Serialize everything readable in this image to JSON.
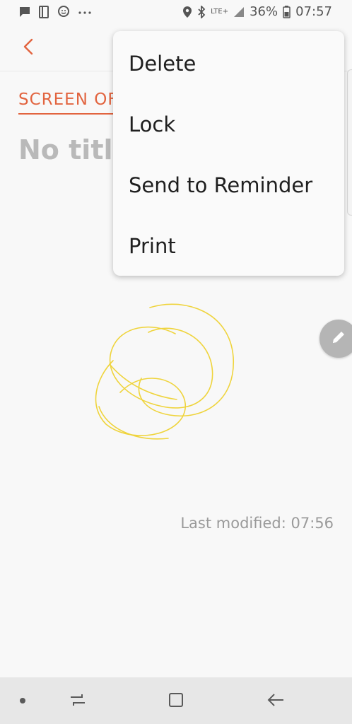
{
  "status_bar": {
    "network": "LTE+",
    "battery": "36%",
    "time": "07:57"
  },
  "note": {
    "category": "SCREEN OF",
    "title": "No title",
    "last_modified": "Last modified: 07:56"
  },
  "menu": {
    "items": [
      "Delete",
      "Lock",
      "Send to Reminder",
      "Print"
    ]
  },
  "icons": {
    "back": "chevron-left-icon",
    "edit": "pencil-icon",
    "recents": "recent-apps-icon",
    "home": "home-icon",
    "nav_back": "back-arrow-icon"
  },
  "colors": {
    "accent": "#e2643f",
    "drawing_stroke": "#efd43d",
    "fab": "#b5b5b5"
  }
}
